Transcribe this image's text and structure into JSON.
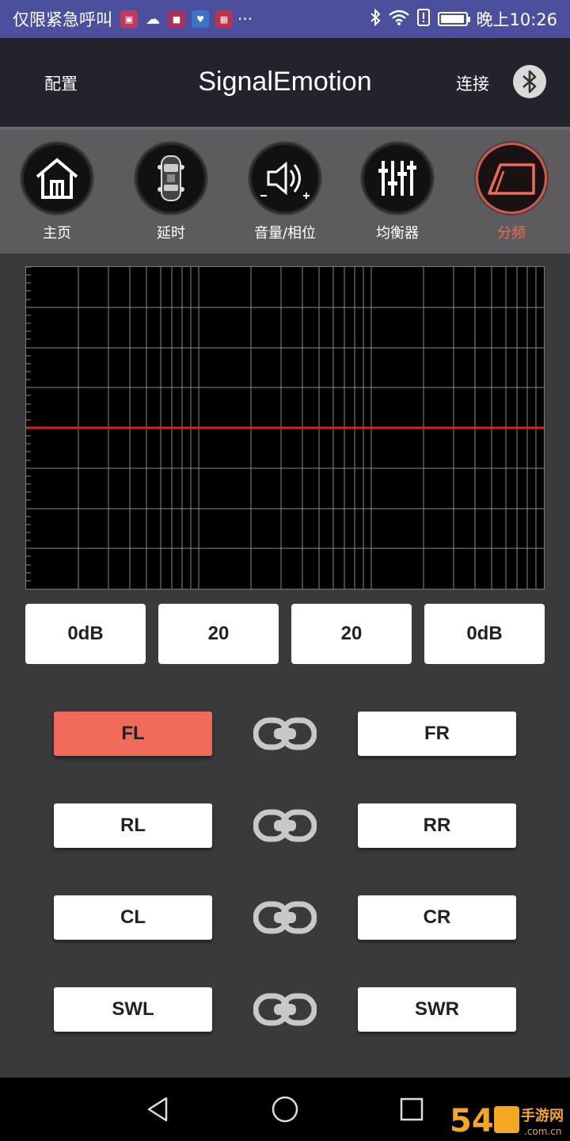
{
  "status_bar": {
    "left_text": "仅限紧急呼叫",
    "more": "···",
    "time": "晚上10:26",
    "battery_level": 0.95
  },
  "header": {
    "config_label": "配置",
    "title": "SignalEmotion",
    "connect_label": "连接"
  },
  "nav": {
    "items": [
      {
        "label": "主页",
        "icon": "home-icon"
      },
      {
        "label": "延时",
        "icon": "car-top-icon"
      },
      {
        "label": "音量/相位",
        "icon": "speaker-icon"
      },
      {
        "label": "均衡器",
        "icon": "equalizer-icon"
      },
      {
        "label": "分频",
        "icon": "crossover-icon"
      }
    ],
    "active_index": 4
  },
  "graph": {
    "line_color": "#e02020",
    "grid_color": "#8a8a8a",
    "flat_response_level": 0.5
  },
  "values": [
    "0dB",
    "20",
    "20",
    "0dB"
  ],
  "channels": {
    "rows": [
      {
        "left": "FL",
        "right": "FR"
      },
      {
        "left": "RL",
        "right": "RR"
      },
      {
        "left": "CL",
        "right": "CR"
      },
      {
        "left": "SWL",
        "right": "SWR"
      }
    ],
    "active": "FL",
    "accent": "#f26a5a"
  },
  "watermark": {
    "number": "54",
    "text": "手游网",
    "domain": ".com.cn"
  }
}
